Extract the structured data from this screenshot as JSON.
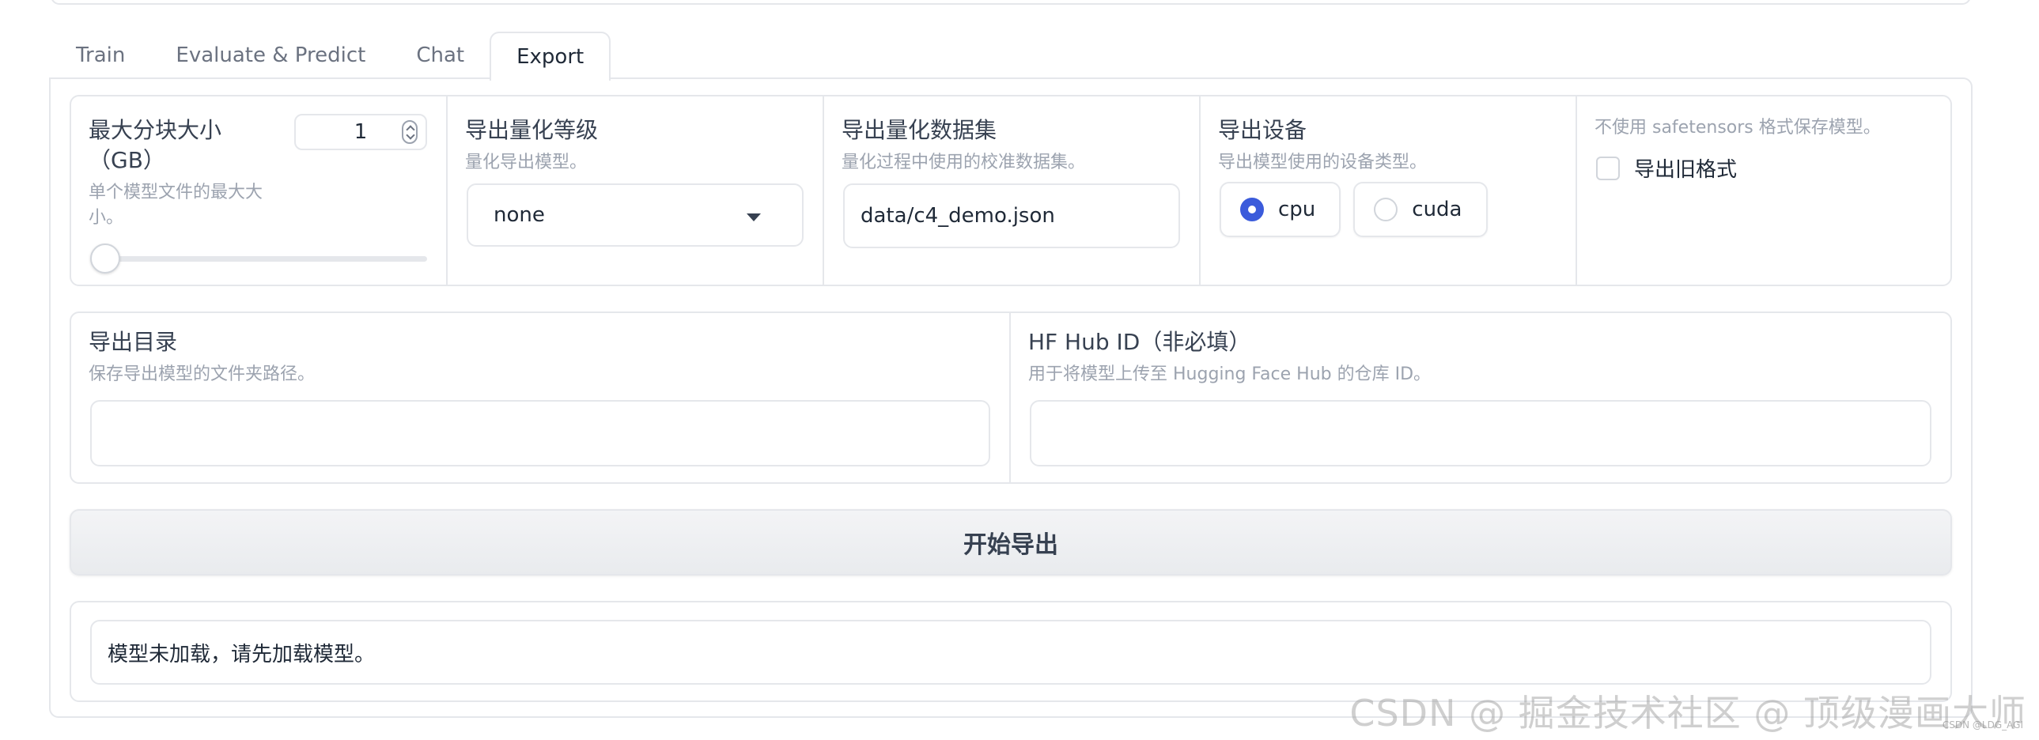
{
  "tabs": [
    {
      "label": "Train"
    },
    {
      "label": "Evaluate & Predict"
    },
    {
      "label": "Chat"
    },
    {
      "label": "Export"
    }
  ],
  "active_tab": "Export",
  "max_shard": {
    "label": "最大分块大小（GB）",
    "info": "单个模型文件的最大大小。",
    "value": "1",
    "slider_value": 1
  },
  "quant_bit": {
    "label": "导出量化等级",
    "info": "量化导出模型。",
    "value": "none"
  },
  "quant_dataset": {
    "label": "导出量化数据集",
    "info": "量化过程中使用的校准数据集。",
    "value": "data/c4_demo.json"
  },
  "device": {
    "label": "导出设备",
    "info": "导出模型使用的设备类型。",
    "options": [
      "cpu",
      "cuda"
    ],
    "selected": "cpu"
  },
  "legacy": {
    "info": "不使用 safetensors 格式保存模型。",
    "label": "导出旧格式",
    "checked": false
  },
  "export_dir": {
    "label": "导出目录",
    "info": "保存导出模型的文件夹路径。",
    "value": ""
  },
  "hub_id": {
    "label": "HF Hub ID（非必填）",
    "info": "用于将模型上传至 Hugging Face Hub 的仓库 ID。",
    "value": ""
  },
  "export_button": "开始导出",
  "output_text": "模型未加载，请先加载模型。",
  "watermark": "CSDN @ 掘金技术社区 @ 顶级漫画大师",
  "watermark_small": "CSDN @LDG_AGI"
}
